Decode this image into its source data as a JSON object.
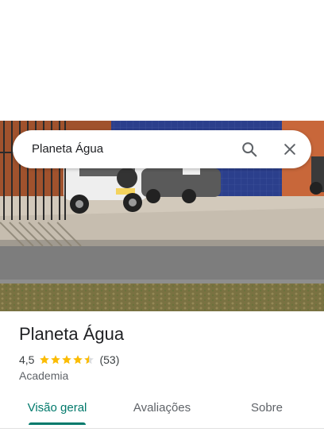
{
  "search": {
    "query": "Planeta Água",
    "search_icon": "search-icon",
    "close_icon": "close-icon"
  },
  "place": {
    "name": "Planeta Água",
    "rating": "4,5",
    "rating_value": 4.5,
    "reviews_count": "(53)",
    "category": "Academia"
  },
  "tabs": [
    {
      "label": "Visão geral",
      "active": true
    },
    {
      "label": "Avaliações",
      "active": false
    },
    {
      "label": "Sobre",
      "active": false
    }
  ],
  "colors": {
    "accent": "#00796b",
    "star": "#fbbc04",
    "star_empty": "#dadce0",
    "text_primary": "#202124",
    "text_secondary": "#5f6368"
  }
}
